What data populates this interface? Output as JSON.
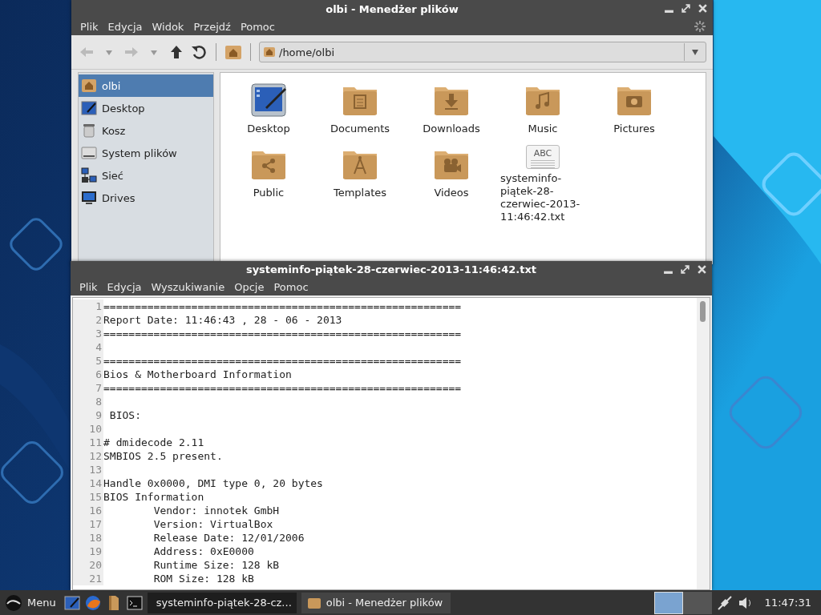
{
  "file_manager": {
    "title": "olbi - Menedżer plików",
    "menu": [
      "Plik",
      "Edycja",
      "Widok",
      "Przejdź",
      "Pomoc"
    ],
    "path": "/home/olbi",
    "sidebar": [
      {
        "label": "olbi",
        "kind": "home",
        "selected": true
      },
      {
        "label": "Desktop",
        "kind": "desktop",
        "selected": false
      },
      {
        "label": "Kosz",
        "kind": "trash",
        "selected": false
      },
      {
        "label": "System plików",
        "kind": "drive",
        "selected": false
      },
      {
        "label": "Sieć",
        "kind": "network",
        "selected": false
      },
      {
        "label": "Drives",
        "kind": "monitor",
        "selected": false
      }
    ],
    "items": [
      {
        "label": "Desktop",
        "kind": "desktop"
      },
      {
        "label": "Documents",
        "kind": "documents"
      },
      {
        "label": "Downloads",
        "kind": "downloads"
      },
      {
        "label": "Music",
        "kind": "music"
      },
      {
        "label": "Pictures",
        "kind": "pictures"
      },
      {
        "label": "Public",
        "kind": "public"
      },
      {
        "label": "Templates",
        "kind": "templates"
      },
      {
        "label": "Videos",
        "kind": "videos"
      },
      {
        "label": "systeminfo-piątek-28-czerwiec-2013-11:46:42.txt",
        "kind": "text",
        "icon_text": "ABC"
      }
    ]
  },
  "editor": {
    "title": "systeminfo-piątek-28-czerwiec-2013-11:46:42.txt",
    "menu": [
      "Plik",
      "Edycja",
      "Wyszukiwanie",
      "Opcje",
      "Pomoc"
    ],
    "lines": [
      {
        "number": "1",
        "text": "========================================================="
      },
      {
        "number": "2",
        "text": "Report Date: 11:46:43 , 28 - 06 - 2013"
      },
      {
        "number": "3",
        "text": "========================================================="
      },
      {
        "number": "4"
      },
      {
        "number": "5",
        "text": "========================================================="
      },
      {
        "number": "6",
        "text": "Bios & Motherboard Information"
      },
      {
        "number": "7",
        "text": "========================================================="
      },
      {
        "number": "8"
      },
      {
        "number": "9",
        "text": " BIOS:"
      },
      {
        "number": "10"
      },
      {
        "number": "11",
        "text": "# dmidecode 2.11"
      },
      {
        "number": "12",
        "text": "SMBIOS 2.5 present."
      },
      {
        "number": "13"
      },
      {
        "number": "14",
        "text": "Handle 0x0000, DMI type 0, 20 bytes"
      },
      {
        "number": "15",
        "text": "BIOS Information"
      },
      {
        "number": "16",
        "text": "\tVendor: innotek GmbH"
      },
      {
        "number": "17",
        "text": "\tVersion: VirtualBox"
      },
      {
        "number": "18",
        "text": "\tRelease Date: 12/01/2006"
      },
      {
        "number": "19",
        "text": "\tAddress: 0xE0000"
      },
      {
        "number": "20",
        "text": "\tRuntime Size: 128 kB"
      },
      {
        "number": "21",
        "text": "\tROM Size: 128 kB"
      }
    ]
  },
  "taskbar": {
    "menu_label": "Menu",
    "tasks": [
      {
        "label": "systeminfo-piątek-28-cz...",
        "kind": "editor",
        "selected": true
      },
      {
        "label": "olbi - Menedżer plików",
        "kind": "folder",
        "selected": false
      }
    ],
    "workspaces": [
      {
        "selected": true
      },
      {
        "selected": false
      }
    ],
    "clock": "11:47:31"
  }
}
